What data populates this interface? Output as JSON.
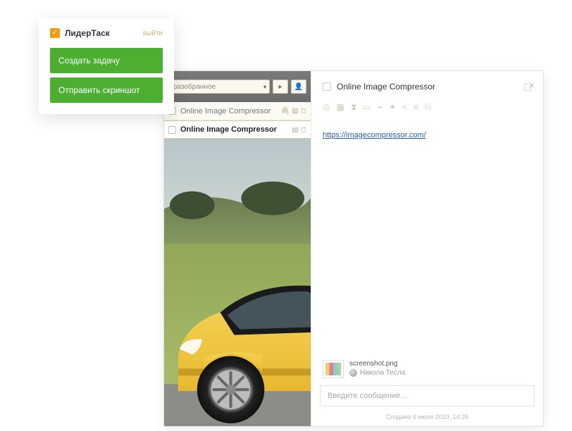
{
  "popup": {
    "brand": "ЛидерТаск",
    "logout": "выйти",
    "create_task": "Создать задачу",
    "send_screenshot": "Отправить скриншот"
  },
  "toolbar": {
    "dropdown_label": "разобранное",
    "btn_play": "▸",
    "btn_user": "👤"
  },
  "tasks": [
    {
      "title": "Online Image Compressor",
      "selected": false
    },
    {
      "title": "Online Image Compressor",
      "selected": true
    }
  ],
  "detail": {
    "title": "Online Image Compressor",
    "link": "https://imagecompressor.com/",
    "attachment": {
      "filename": "screenshot.png",
      "author": "Никола Тесла"
    },
    "message_placeholder": "Введите сообщение...",
    "created": "Создано 6 июля 2020, 14:35"
  }
}
